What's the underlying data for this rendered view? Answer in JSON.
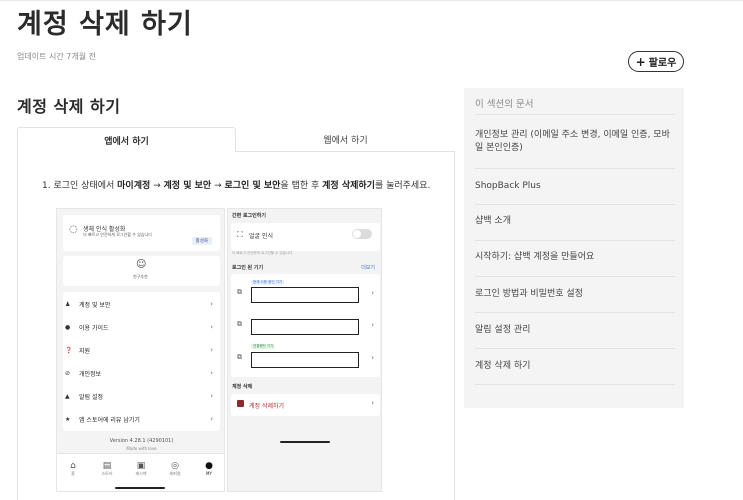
{
  "header": {
    "title": "계정 삭제 하기",
    "updated": "업데이트 시간 7개월 전",
    "follow_label": "팔로우"
  },
  "article": {
    "section_title": "계정 삭제 하기",
    "tabs": [
      {
        "label": "앱에서 하기",
        "active": true
      },
      {
        "label": "웹에서 하기",
        "active": false
      }
    ],
    "step_prefix": "1. 로그인 상태에서 ",
    "step_b1": "마이계정",
    "step_arrow1": " → ",
    "step_b2": "계정 및 보안",
    "step_arrow2": " → ",
    "step_b3": "로그인 및 보안",
    "step_mid": "을 탭한 후 ",
    "step_b4": "계정 삭제하기",
    "step_suffix": "를 눌러주세요."
  },
  "screenshot": {
    "left": {
      "bio_title": "생체 인식 활성화",
      "bio_sub": "더 빠르고 안전하게 로그인할 수 있습니다",
      "bio_badge": "활성화",
      "referral": "친구추천",
      "menu": [
        {
          "icon": "person-icon",
          "glyph": "♟",
          "label": "계정 및 보안"
        },
        {
          "icon": "info-icon",
          "glyph": "●",
          "label": "이용 가이드"
        },
        {
          "icon": "help-icon",
          "glyph": "❓",
          "label": "지원"
        },
        {
          "icon": "privacy-icon",
          "glyph": "⊘",
          "label": "개인정보"
        },
        {
          "icon": "bell-icon",
          "glyph": "▲",
          "label": "알림 설정"
        },
        {
          "icon": "star-icon",
          "glyph": "★",
          "label": "앱 스토어에 리뷰 남기기"
        }
      ],
      "version": "Version 4.28.1 (4290101)",
      "made_with": "Made with love",
      "nav": [
        {
          "glyph": "⌂",
          "label": "홈"
        },
        {
          "glyph": "▤",
          "label": "스토어"
        },
        {
          "glyph": "▣",
          "label": "캐시백"
        },
        {
          "glyph": "◎",
          "label": "레퍼럴"
        },
        {
          "glyph": "●",
          "label": "MY"
        }
      ]
    },
    "right": {
      "quick_login": "간편 로그인하기",
      "face_id": "얼굴 인식",
      "face_sub": "더 빠르고 안전하게 로그인할 수 있습니다",
      "login_section": "로그인 된 기기",
      "view_more": "더보기",
      "device_tag1": "현재 사용 중인 기기",
      "device_tag3": "연결했던 기기",
      "delete_section": "계정 삭제",
      "delete_item": "계정 삭제하기"
    }
  },
  "sidebar": {
    "title": "이 섹션의 문서",
    "items": [
      "개인정보 관리 (이메일 주소 변경, 이메일 인증, 모바일 본인인증)",
      "ShopBack Plus",
      "샵백 소개",
      "시작하기: 샵백 계정을 만들어요",
      "로그인 방법과 비밀번호 설정",
      "알림 설정 관리",
      "계정 삭제 하기"
    ]
  }
}
